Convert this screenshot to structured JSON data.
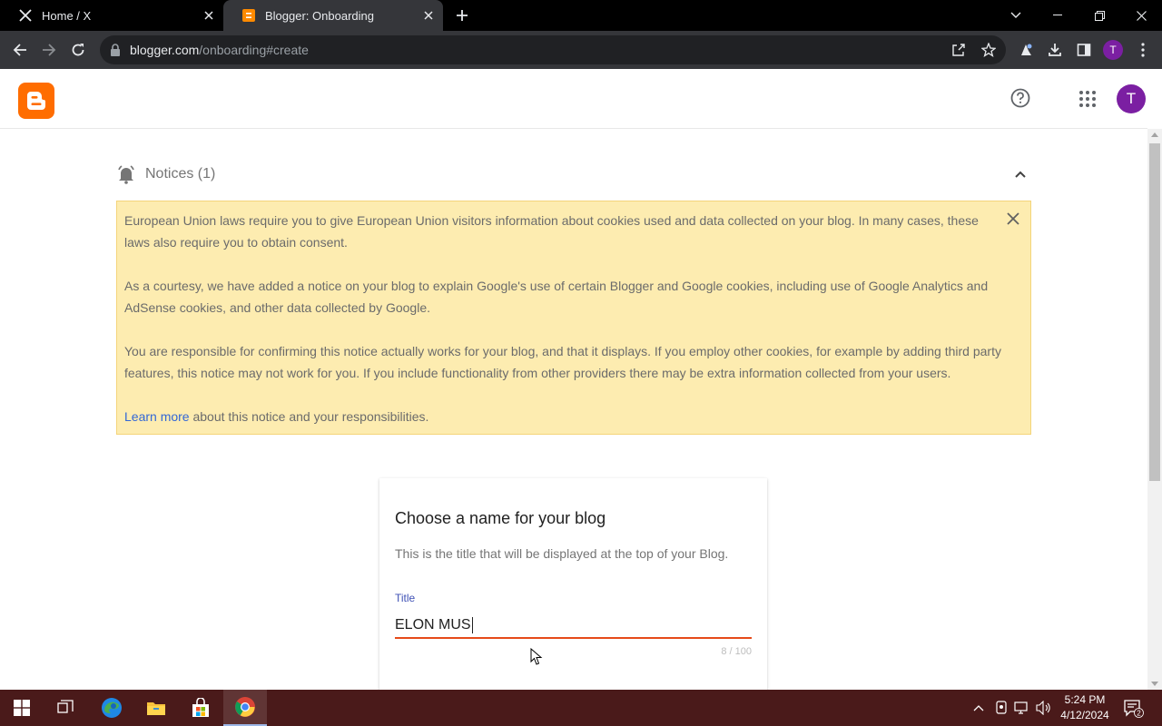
{
  "browser": {
    "tabs": [
      {
        "title": "Home / X",
        "active": false
      },
      {
        "title": "Blogger: Onboarding",
        "active": true
      }
    ],
    "url_host": "blogger.com",
    "url_path": "/onboarding#create",
    "profile_initial": "T"
  },
  "appbar": {
    "avatar_initial": "T"
  },
  "notices": {
    "header": "Notices (1)",
    "paragraphs": [
      "European Union laws require you to give European Union visitors information about cookies used and data collected on your blog. In many cases, these laws also require you to obtain consent.",
      "As a courtesy, we have added a notice on your blog to explain Google's use of certain Blogger and Google cookies, including use of Google Analytics and AdSense cookies, and other data collected by Google.",
      "You are responsible for confirming this notice actually works for your blog, and that it displays. If you employ other cookies, for example by adding third party features, this notice may not work for you. If you include functionality from other providers there may be extra information collected from your users."
    ],
    "learn_more_link": "Learn more",
    "learn_more_suffix": " about this notice and your responsibilities."
  },
  "create_blog": {
    "heading": "Choose a name for your blog",
    "subtext": "This is the title that will be displayed at the top of your Blog.",
    "field_label": "Title",
    "field_value": "ELON MUS",
    "counter": "8 / 100"
  },
  "taskbar": {
    "time": "5:24 PM",
    "date": "4/12/2024",
    "notification_count": "2"
  },
  "colors": {
    "blogger_orange": "#ff6d00",
    "notice_bg": "#fdecb0",
    "input_underline": "#e64a19",
    "avatar_purple": "#7b1fa2"
  }
}
